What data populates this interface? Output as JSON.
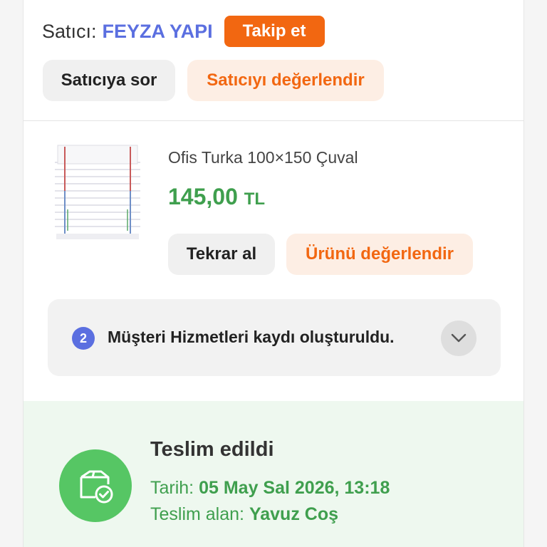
{
  "seller": {
    "label": "Satıcı:",
    "name": "FEYZA YAPI",
    "follow_label": "Takip et",
    "ask_label": "Satıcıya sor",
    "rate_label": "Satıcıyı değerlendir"
  },
  "product": {
    "title": "Ofis Turka 100×150 Çuval",
    "price": "145,00",
    "currency": "TL",
    "reorder_label": "Tekrar al",
    "rate_label": "Ürünü değerlendir"
  },
  "notice": {
    "count": "2",
    "text": "Müşteri Hizmetleri kaydı oluşturuldu.",
    "icon": "chevron-down-icon"
  },
  "delivery": {
    "status": "Teslim edildi",
    "date_label": "Tarih:",
    "date_value": "05 May Sal 2026, 13:18",
    "receiver_label": "Teslim alan:",
    "receiver_value": "Yavuz Coş",
    "icon": "delivered-box-icon"
  },
  "colors": {
    "accent_orange": "#f26711",
    "seller_blue": "#5b6fe0",
    "price_green": "#3f9f4e",
    "delivered_green": "#56c664"
  }
}
